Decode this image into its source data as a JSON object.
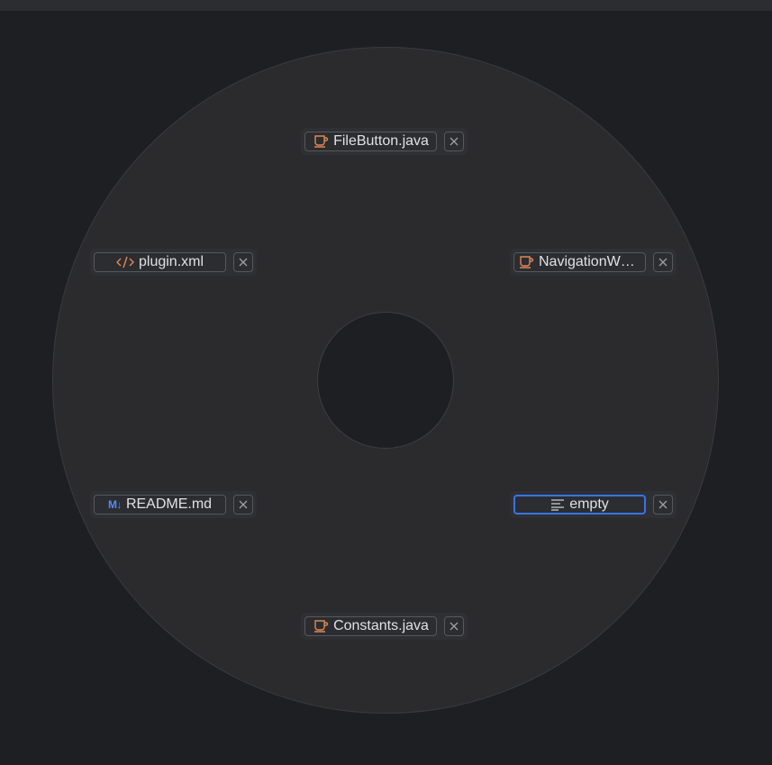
{
  "switcher": {
    "tabs": [
      {
        "label": "FileButton.java",
        "icon": "java-cup-icon"
      },
      {
        "label": "plugin.xml",
        "icon": "xml-code-icon"
      },
      {
        "label": "NavigationWh…",
        "icon": "java-cup-icon"
      },
      {
        "label": "README.md",
        "icon": "markdown-icon",
        "icon_text": "M↓"
      },
      {
        "label": "empty",
        "icon": "text-file-icon",
        "selected": true
      },
      {
        "label": "Constants.java",
        "icon": "java-cup-icon"
      }
    ]
  },
  "colors": {
    "background": "#1e1f22",
    "wheel": "#2b2b2d",
    "selection": "#3574f0",
    "java_icon": "#e08855",
    "markdown_icon": "#548af7"
  }
}
